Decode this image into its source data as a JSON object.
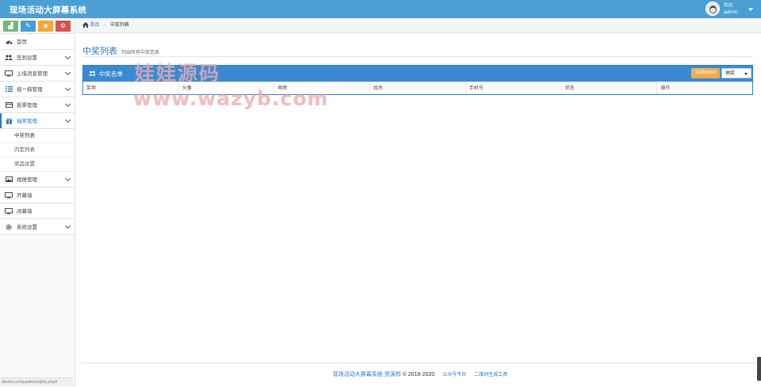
{
  "app": {
    "title": "现场活动大屏幕系统"
  },
  "user": {
    "welcome": "欢迎,",
    "name": "admin"
  },
  "quick_buttons": [
    {
      "icon": "chart-icon",
      "glyph": "▟",
      "color": "#73b873"
    },
    {
      "icon": "pencil-icon",
      "glyph": "✎",
      "color": "#4b9cd6"
    },
    {
      "icon": "users-icon",
      "glyph": "☻",
      "color": "#f5a733"
    },
    {
      "icon": "cogs-icon",
      "glyph": "⚙",
      "color": "#d9534f"
    }
  ],
  "sidebar": {
    "items": [
      {
        "label": "首页",
        "icon": "dashboard-icon",
        "chevron": false
      },
      {
        "label": "签到设置",
        "icon": "users-icon",
        "chevron": true
      },
      {
        "label": "上墙消息管理",
        "icon": "desktop-icon",
        "chevron": true
      },
      {
        "label": "摇一摇管理",
        "icon": "list-icon",
        "chevron": true
      },
      {
        "label": "投票管理",
        "icon": "credit-card-icon",
        "chevron": true
      },
      {
        "label": "抽奖管理",
        "icon": "gift-icon",
        "chevron": true,
        "active": true,
        "children": [
          "中奖列表",
          "内定列表",
          "奖品设置"
        ]
      },
      {
        "label": "相册管理",
        "icon": "picture-icon",
        "chevron": true
      },
      {
        "label": "开幕墙",
        "icon": "desktop-icon",
        "chevron": false
      },
      {
        "label": "闭幕墙",
        "icon": "desktop-icon",
        "chevron": false
      },
      {
        "label": "系统设置",
        "icon": "gear-icon",
        "chevron": true
      }
    ]
  },
  "breadcrumb": {
    "home": "首页",
    "current": "中奖列表"
  },
  "page": {
    "title": "中奖列表",
    "subtitle": "列出所有中奖信息"
  },
  "panel": {
    "title": "中奖名单",
    "export_label": "导出excel",
    "select_value": "抽奖",
    "columns": [
      "奖项",
      "头像",
      "昵称",
      "姓名",
      "手机号",
      "状态",
      "操作"
    ]
  },
  "watermark": {
    "line1": "娃娃源码",
    "line2": "www.wazyb.com"
  },
  "footer": {
    "brand": "现场活动大屏幕系统",
    "site": "资源邦",
    "copyright": "© 2016-2020",
    "link1": "公众号平台",
    "link2": "二维码生成工具"
  },
  "status_url": "demo.cc/myadmin/zjlist.php#"
}
